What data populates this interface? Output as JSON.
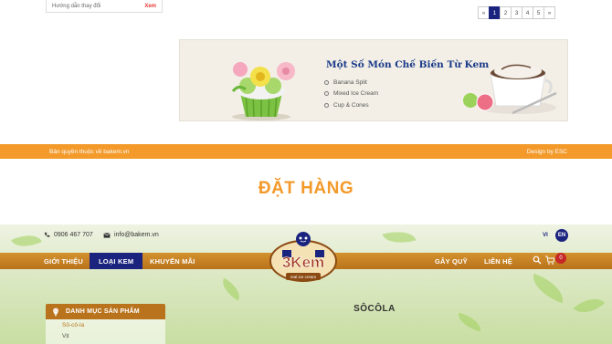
{
  "top_card": {
    "text": "Hướng dẫn thay đổi",
    "price": "Xem"
  },
  "pagination": {
    "prev": "«",
    "pages": [
      "1",
      "2",
      "3",
      "4",
      "5"
    ],
    "active_page": "1",
    "next": "»"
  },
  "promo": {
    "title": "Một Số Món Chế Biến Từ Kem",
    "items": [
      "Banana Split",
      "Mixed Ice Cream",
      "Cup & Cones"
    ]
  },
  "footer_bar": {
    "copyright": "Bản quyền thuộc về bakem.vn",
    "design": "Design by ESC"
  },
  "order_heading": "ĐẶT HÀNG",
  "topbar": {
    "phone": "0906 467 707",
    "email": "info@bakem.vn",
    "lang_vi": "VI",
    "lang_en": "EN"
  },
  "nav": {
    "items": [
      "GIỚI THIỆU",
      "LOẠI KEM",
      "KHUYẾN MÃI",
      "GÂY QUỸ",
      "LIÊN HỆ"
    ],
    "active": "LOẠI KEM",
    "cart_count": "0"
  },
  "logo": {
    "text": "3Kem",
    "tagline": "real ice cream"
  },
  "sidebar": {
    "heading": "DANH MỤC SẢN PHẨM",
    "items": [
      "Sô-cô-la",
      "Vịt"
    ]
  },
  "category_title": "SÔCÔLA",
  "colors": {
    "accent_orange": "#f39a2b",
    "nav_brown": "#b9731c",
    "navy": "#1a237e"
  }
}
